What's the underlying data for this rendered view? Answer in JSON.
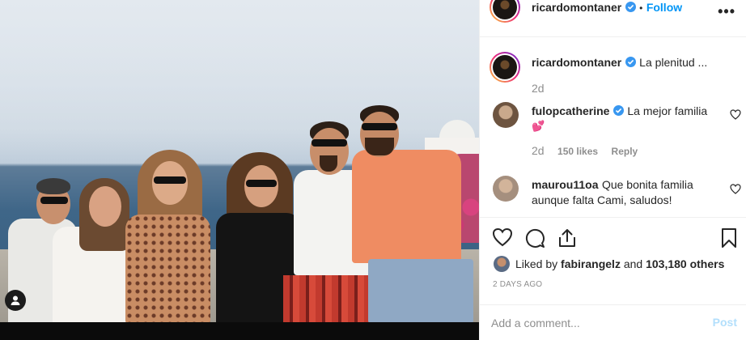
{
  "post": {
    "author": "ricardomontaner",
    "follow_separator": "•",
    "follow_label": "Follow",
    "more_glyph": "•••",
    "caption_author": "ricardomontaner",
    "caption_text": "La plenitud ...",
    "caption_age": "2d"
  },
  "comments": [
    {
      "user": "fulopcatherine",
      "text": "La mejor familia",
      "emoji": "💕",
      "age": "2d",
      "likes": "150 likes",
      "reply": "Reply"
    },
    {
      "user": "maurou11oa",
      "text": "Que bonita familia aunque falta Cami, saludos!"
    }
  ],
  "likes": {
    "prefix": "Liked by",
    "user": "fabirangelz",
    "connector": "and",
    "others": "103,180 others"
  },
  "timestamp": "2 DAYS AGO",
  "add_comment": {
    "placeholder": "Add a comment...",
    "post_label": "Post"
  },
  "icons": {
    "verified": "verified-badge-icon",
    "heart": "heart-icon",
    "comment": "comment-icon",
    "share": "share-icon",
    "save": "bookmark-icon",
    "user_tags": "user-tag-icon"
  },
  "colors": {
    "link_blue": "#0095f6",
    "verified_blue": "#3897f0",
    "muted": "#8e8e8e",
    "text": "#262626"
  }
}
